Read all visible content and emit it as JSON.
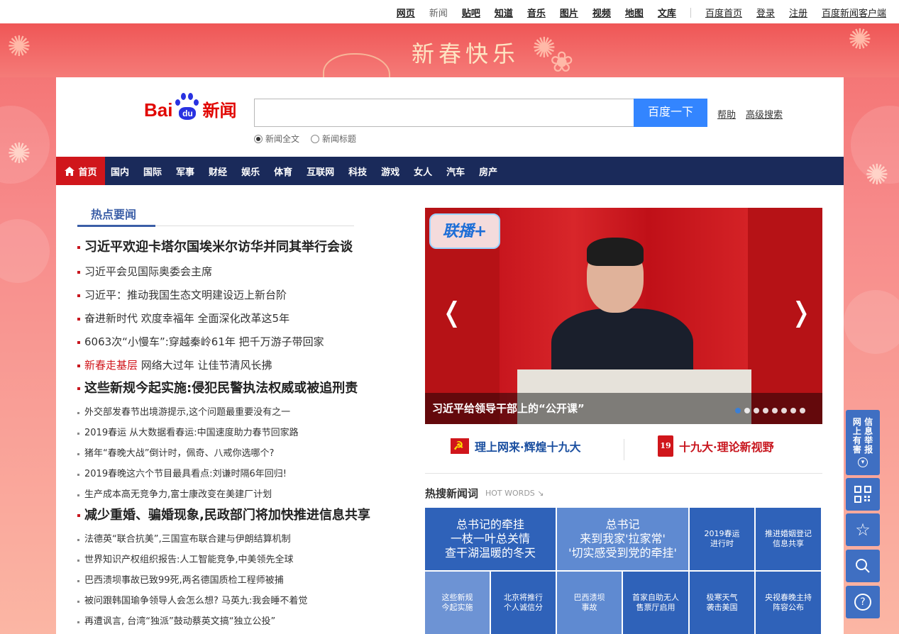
{
  "topnav": {
    "links": [
      {
        "label": "网页",
        "style": "bold"
      },
      {
        "label": "新闻",
        "style": "nou"
      },
      {
        "label": "贴吧",
        "style": "bold"
      },
      {
        "label": "知道",
        "style": "bold"
      },
      {
        "label": "音乐",
        "style": "bold"
      },
      {
        "label": "图片",
        "style": "bold"
      },
      {
        "label": "视频",
        "style": "bold"
      },
      {
        "label": "地图",
        "style": "bold"
      },
      {
        "label": "文库",
        "style": "bold"
      }
    ],
    "right_links": [
      "百度首页",
      "登录",
      "注册",
      "百度新闻客户端"
    ]
  },
  "banner": {
    "title": "新春快乐"
  },
  "logo": {
    "bai": "Bai",
    "du": "du",
    "news": "新闻"
  },
  "search": {
    "value": "",
    "button_label": "百度一下",
    "help": "帮助",
    "advanced": "高级搜索",
    "radio_full": "新闻全文",
    "radio_title": "新闻标题",
    "selected": "新闻全文"
  },
  "channels": {
    "home": "首页",
    "items": [
      "国内",
      "国际",
      "军事",
      "财经",
      "娱乐",
      "体育",
      "互联网",
      "科技",
      "游戏",
      "女人",
      "汽车",
      "房产"
    ]
  },
  "hot": {
    "title": "热点要闻",
    "items": [
      {
        "size": "big",
        "text": "习近平欢迎卡塔尔国埃米尔访华并同其举行会谈"
      },
      {
        "size": "mid",
        "text": "习近平会见国际奥委会主席"
      },
      {
        "size": "mid",
        "text": "习近平：推动我国生态文明建设迈上新台阶"
      },
      {
        "size": "mid",
        "text": "奋进新时代 欢度幸福年 全面深化改革这5年"
      },
      {
        "size": "mid",
        "text": "6063次“小慢车”:穿越秦岭61年 把千万游子带回家"
      },
      {
        "size": "mid",
        "red": "新春走基层",
        "text": " 网络大过年 让佳节清风长拂"
      },
      {
        "size": "big",
        "text": "这些新规今起实施:侵犯民警执法权威或被追刑责"
      },
      {
        "size": "sm",
        "text": "外交部发春节出境游提示,这个问题最重要没有之一"
      },
      {
        "size": "sm",
        "text": "2019春运 从大数据看春运:中国速度助力春节回家路"
      },
      {
        "size": "sm",
        "text": "猪年“春晚大战”倒计时，佩奇、八戒你选哪个?"
      },
      {
        "size": "sm",
        "text": "2019春晚这六个节目最具看点:刘谦时隔6年回归!"
      },
      {
        "size": "sm",
        "text": "生产成本高无竞争力,富士康改变在美建厂计划"
      },
      {
        "size": "big",
        "text": "减少重婚、骗婚现象,民政部门将加快推进信息共享"
      },
      {
        "size": "sm",
        "text": "法德英“联合抗美”,三国宣布联合建与伊朗结算机制"
      },
      {
        "size": "sm",
        "text": "世界知识产权组织报告:人工智能竞争,中美领先全球"
      },
      {
        "size": "sm",
        "text": "巴西溃坝事故已致99死,两名德国质检工程师被捕"
      },
      {
        "size": "sm",
        "text": "被问跟韩国瑜争领导人会怎么想? 马英九:我会睡不着觉"
      },
      {
        "size": "sm",
        "text": "再遭讽言, 台湾“独派”鼓动蔡英文搞“独立公投”"
      }
    ]
  },
  "slideshow": {
    "badge": "联播+",
    "caption": "习近平给领导干部上的“公开课”",
    "prev": "❬",
    "next": "❭",
    "active_dot": 0,
    "dot_count": 8
  },
  "promos": [
    {
      "text": "理上网来·辉煌十九大",
      "color": "#1b4fa0"
    },
    {
      "text": "十九大·理论新视野",
      "color": "#c8161e",
      "badge": "19"
    }
  ],
  "hotwords": {
    "title": "热搜新闻词",
    "sub": "HOT WORDS ↘",
    "cells": [
      {
        "text": "总书记的牵挂\n一枝一叶总关情\n查干湖温暖的冬天",
        "bg": "#2f62b9",
        "fs": 16
      },
      {
        "text": "总书记\n来到我家'拉家常'\n'切实感受到党的牵挂'",
        "bg": "#5f8ad1",
        "fs": 16
      },
      {
        "text": "2019春运\n进行时",
        "bg": "#2f62b9",
        "fs": 11
      },
      {
        "text": "推进婚姻登记\n信息共享",
        "bg": "#2f62b9",
        "fs": 11
      },
      {
        "text": "这些新规\n今起实施",
        "bg": "#6d93d4",
        "fs": 11
      },
      {
        "text": "北京将推行\n个人诚信分",
        "bg": "#2f62b9",
        "fs": 11
      },
      {
        "text": "巴西溃坝\n事故",
        "bg": "#5f8ad1",
        "fs": 11
      },
      {
        "text": "首家自助无人\n售票厅启用",
        "bg": "#2f62b9",
        "fs": 11
      },
      {
        "text": "极寒天气\n袭击美国",
        "bg": "#2f62b9",
        "fs": 11
      },
      {
        "text": "央视春晚主持\n阵容公布",
        "bg": "#2f62b9",
        "fs": 11
      }
    ]
  },
  "tools": {
    "report": "网\n上\n有\n害\n信\n息\n举\n报",
    "report_lines": [
      "网 信",
      "上 息",
      "有 举",
      "害 报"
    ]
  }
}
